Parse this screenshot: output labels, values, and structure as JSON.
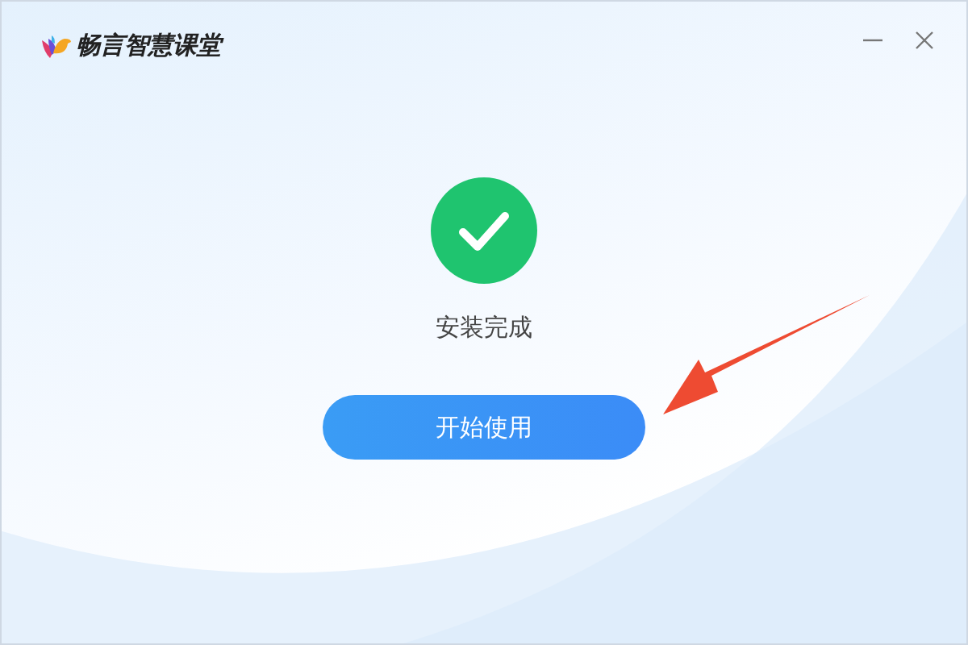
{
  "window": {
    "title": "畅言智慧课堂"
  },
  "status": {
    "text": "安装完成"
  },
  "button": {
    "label": "开始使用"
  }
}
